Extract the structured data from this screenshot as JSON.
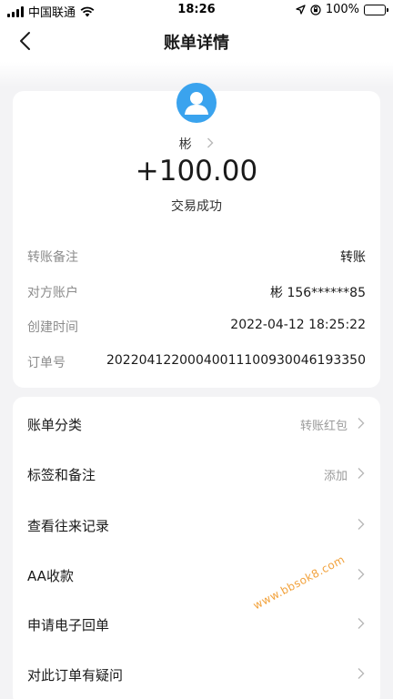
{
  "status_bar": {
    "carrier": "中国联通",
    "time": "18:26",
    "battery": "100%",
    "icons": [
      "signal-icon",
      "wifi-icon",
      "location-icon",
      "lock-rotation-icon",
      "battery-icon"
    ]
  },
  "nav": {
    "title": "账单详情",
    "back_icon": "chevron-left-icon"
  },
  "summary": {
    "avatar_icon": "user-avatar-icon",
    "counterparty": "彬",
    "amount": "+100.00",
    "status": "交易成功",
    "details": [
      {
        "label": "转账备注",
        "value": "转账"
      },
      {
        "label": "对方账户",
        "value": "彬 156******85"
      },
      {
        "label": "创建时间",
        "value": "2022-04-12 18:25:22"
      },
      {
        "label": "订单号",
        "value": "20220412200040011100930046193350"
      }
    ]
  },
  "menu": [
    {
      "label": "账单分类",
      "value": "转账红包"
    },
    {
      "label": "标签和备注",
      "value": "添加"
    },
    {
      "label": "查看往来记录",
      "value": ""
    },
    {
      "label": "AA收款",
      "value": ""
    },
    {
      "label": "申请电子回单",
      "value": ""
    },
    {
      "label": "对此订单有疑问",
      "value": ""
    }
  ],
  "watermark": "www.bbsok8.com",
  "colors": {
    "avatar_bg": "#3aa3ee",
    "watermark": "#f2a23c",
    "page_bg": "#f3f3f5"
  }
}
